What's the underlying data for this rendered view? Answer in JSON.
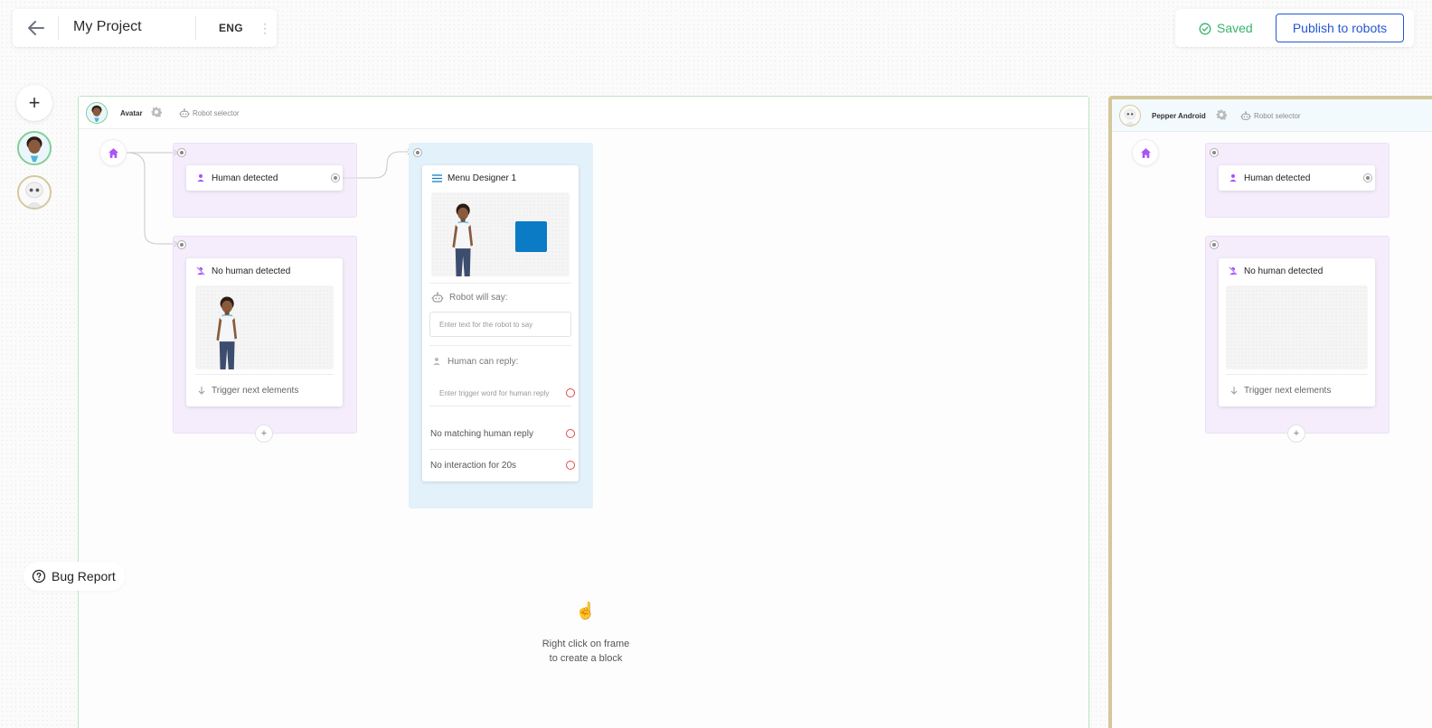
{
  "header": {
    "project_title": "My Project",
    "language": "ENG",
    "saved_label": "Saved",
    "publish_label": "Publish to robots"
  },
  "rail": {
    "add_label": "+",
    "bug_report_label": "Bug Report"
  },
  "frames": [
    {
      "robot_name": "Avatar",
      "robot_selector_label": "Robot selector",
      "border_color": "#b9e4c4",
      "human_detected_label": "Human detected",
      "no_human_detected_label": "No human detected",
      "trigger_next_label": "Trigger next elements",
      "menu": {
        "title": "Menu Designer 1",
        "robot_will_say_label": "Robot will say:",
        "say_placeholder": "Enter text for the robot to say",
        "human_can_reply_label": "Human can reply:",
        "reply_placeholder": "Enter trigger word for human reply",
        "no_match_label": "No matching human reply",
        "no_interaction_label": "No interaction for 20s",
        "accent_color": "#0a7bc4"
      },
      "hint": {
        "icon": "pointing-hand-icon",
        "line1": "Right click on frame",
        "line2": "to create a block"
      }
    },
    {
      "robot_name": "Pepper Android",
      "robot_selector_label": "Robot selector",
      "border_color": "#d4c89b",
      "human_detected_label": "Human detected",
      "no_human_detected_label": "No human detected",
      "trigger_next_label": "Trigger next elements"
    }
  ],
  "colors": {
    "accent_purple": "#a855f7",
    "publish_blue": "#2456d6",
    "saved_green": "#38b36d",
    "error_red": "#e8464a"
  }
}
